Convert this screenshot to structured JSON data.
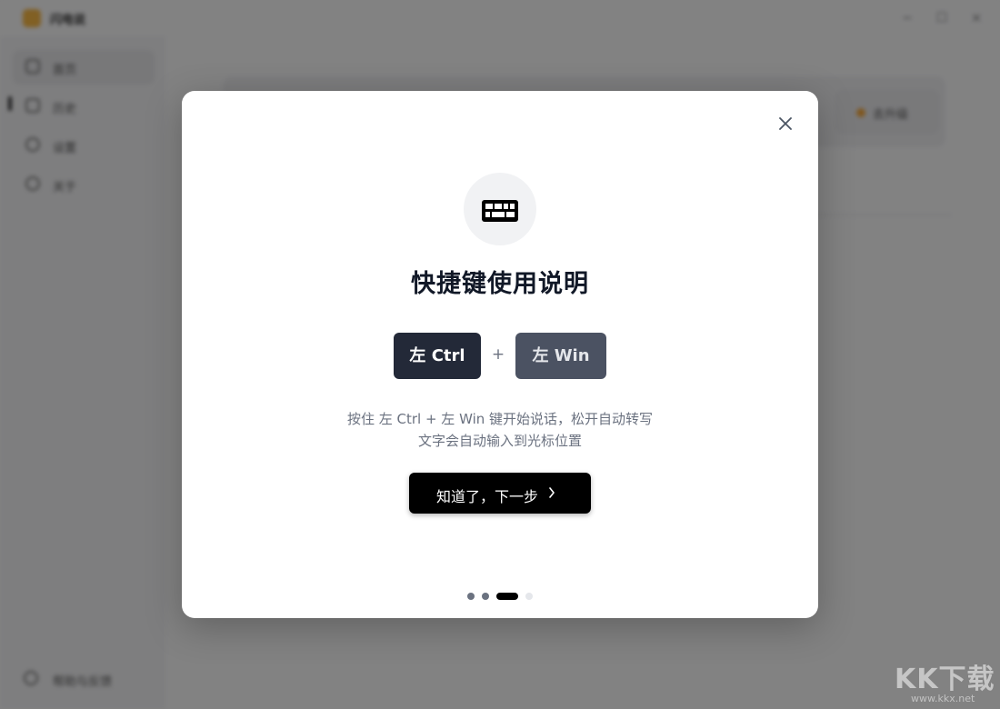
{
  "app": {
    "name": "闪电说",
    "sidebar": {
      "items": [
        {
          "label": "首页",
          "icon": "home-icon"
        },
        {
          "label": "历史",
          "icon": "history-icon"
        },
        {
          "label": "设置",
          "icon": "settings-icon"
        },
        {
          "label": "关于",
          "icon": "info-icon"
        }
      ],
      "footer_label": "帮助与反馈"
    },
    "main": {
      "pill_label": "去升级"
    },
    "window_controls": {
      "minimize": "−",
      "maximize": "☐",
      "close": "×"
    }
  },
  "modal": {
    "icon": "keyboard-icon",
    "title": "快捷键使用说明",
    "keys": [
      "左 Ctrl",
      "左 Win"
    ],
    "plus": "+",
    "description": [
      "按住 左 Ctrl + 左 Win 键开始说话，松开自动转写",
      "文字会自动输入到光标位置"
    ],
    "next_button_label": "知道了，下一步",
    "steps": {
      "total": 4,
      "current": 3
    }
  },
  "watermark": {
    "text": "KK下载",
    "sub": "www.kkx.net"
  },
  "colors": {
    "overlay": "#000000",
    "key_primary": "#232938",
    "key_secondary": "#4b5262",
    "button": "#000000",
    "title": "#111827",
    "text_muted": "#6b7280"
  }
}
